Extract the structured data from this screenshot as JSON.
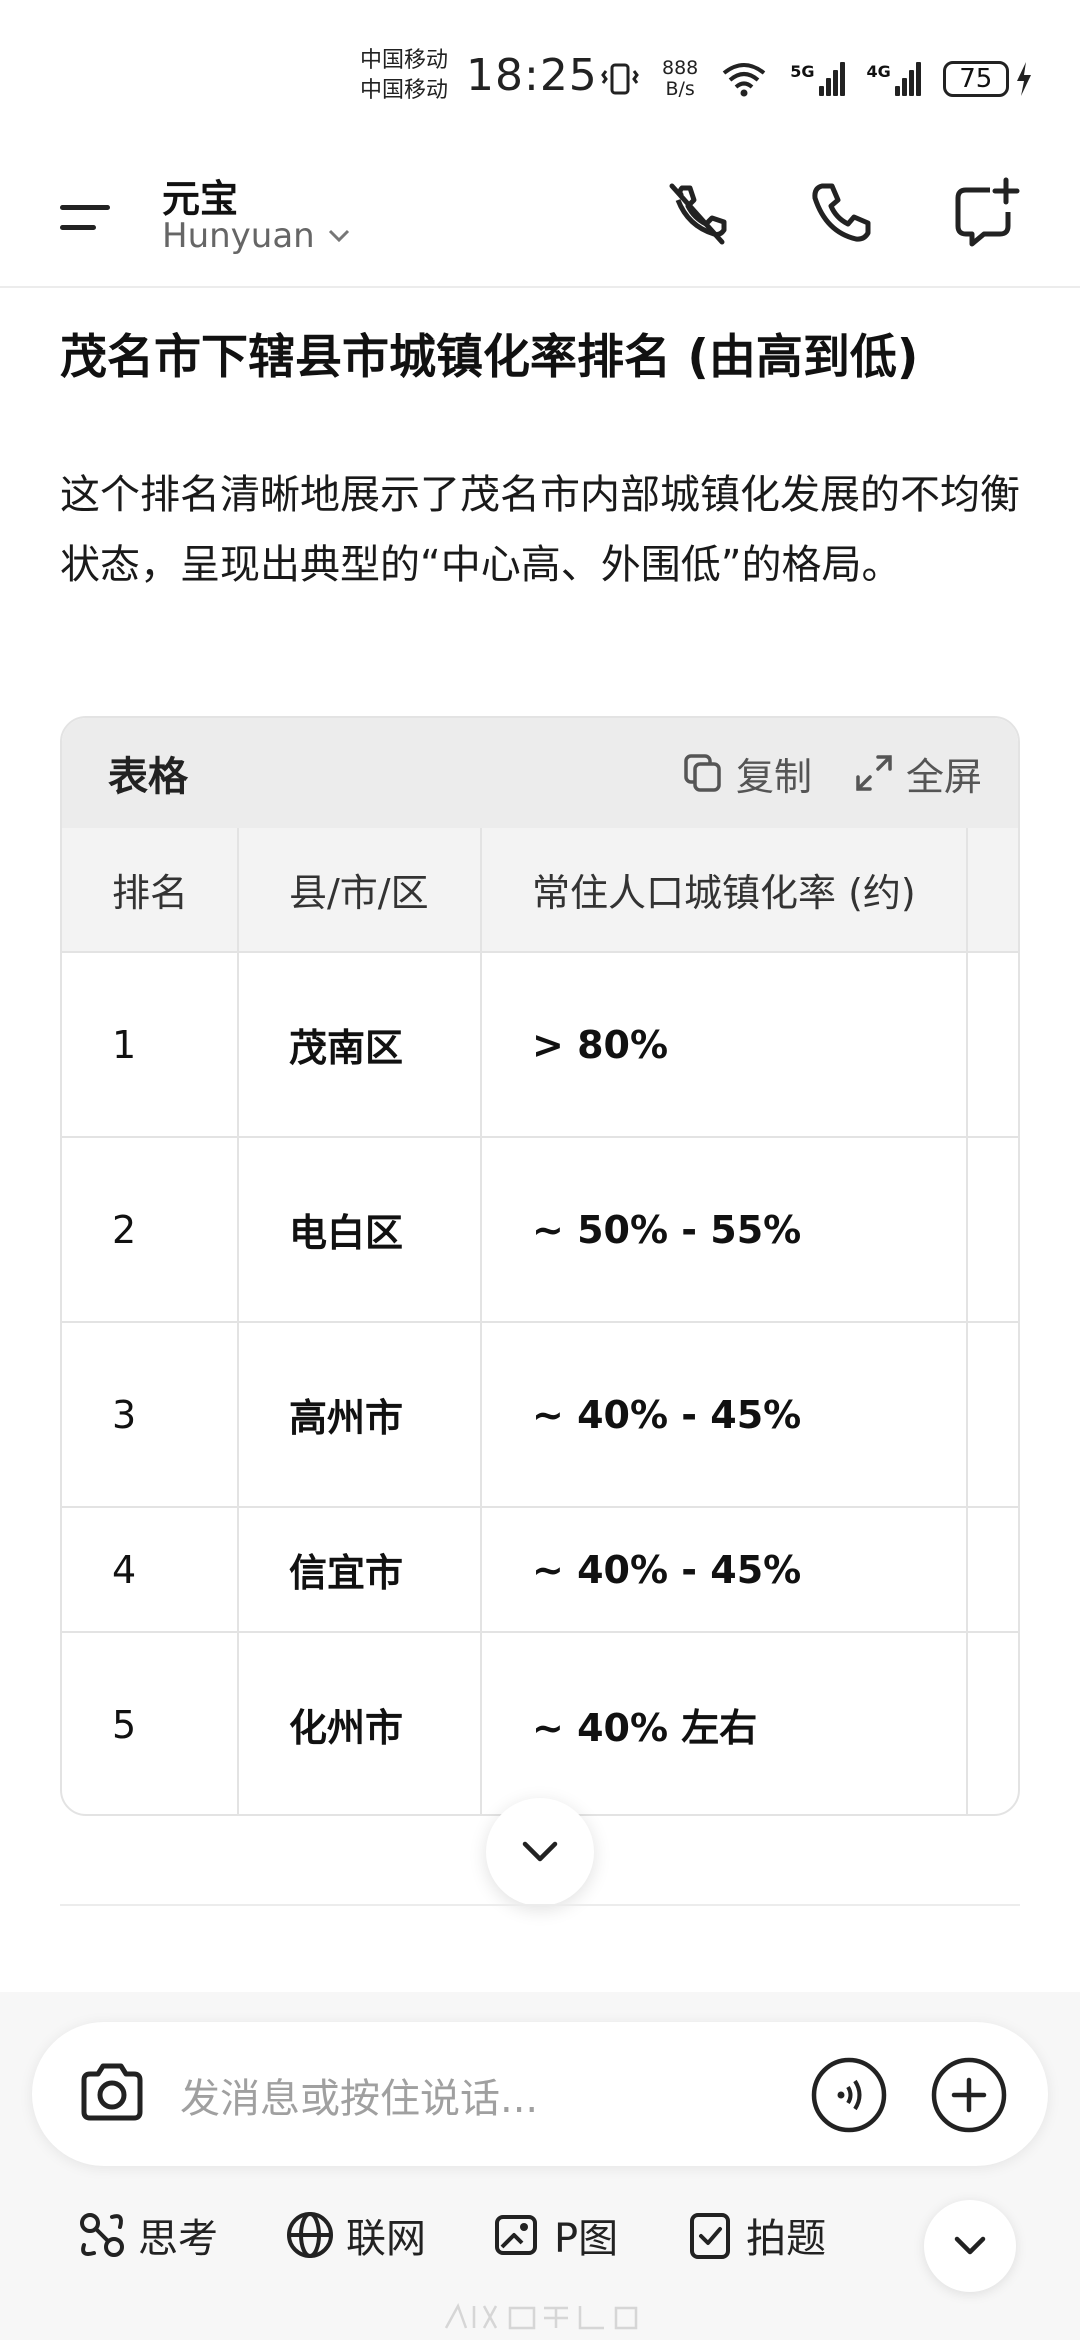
{
  "status_bar": {
    "carrier_1": "中国移动",
    "carrier_2": "中国移动",
    "time": "18:25",
    "net_speed_value": "888",
    "net_speed_unit": "B/s",
    "signal_1": "5G",
    "signal_2": "4G",
    "battery": "75"
  },
  "header": {
    "title": "元宝",
    "model": "Hunyuan",
    "icons": [
      "mute-icon",
      "phone-icon",
      "new-chat-icon"
    ]
  },
  "content": {
    "heading": "茂名市下辖县市城镇化率排名 (由高到低)",
    "paragraph": "这个排名清晰地展示了茂名市内部城镇化发展的不均衡状态，呈现出典型的“中心高、外围低”的格局。"
  },
  "table_card": {
    "title": "表格",
    "copy_label": "复制",
    "fullscreen_label": "全屏",
    "columns": [
      "排名",
      "县/市/区",
      "常住人口城镇化率 (约)"
    ],
    "rows": [
      {
        "rank": "1",
        "name": "茂南区",
        "rate": "> 80%"
      },
      {
        "rank": "2",
        "name": "电白区",
        "rate": "~ 50% - 55%"
      },
      {
        "rank": "3",
        "name": "高州市",
        "rate": "~ 40% - 45%"
      },
      {
        "rank": "4",
        "name": "信宜市",
        "rate": "~ 40% - 45%"
      },
      {
        "rank": "5",
        "name": "化州市",
        "rate": "~ 40% 左右"
      }
    ]
  },
  "input": {
    "placeholder": "发消息或按住说话..."
  },
  "toolbar": {
    "think": "思考",
    "web": "联网",
    "pimage": "P图",
    "photo_question": "拍题"
  },
  "colors": {
    "text_primary": "#111111",
    "text_secondary": "#666666",
    "card_header_bg": "#ececec",
    "table_header_bg": "#f3f3f3",
    "border": "#e3e3e3"
  }
}
